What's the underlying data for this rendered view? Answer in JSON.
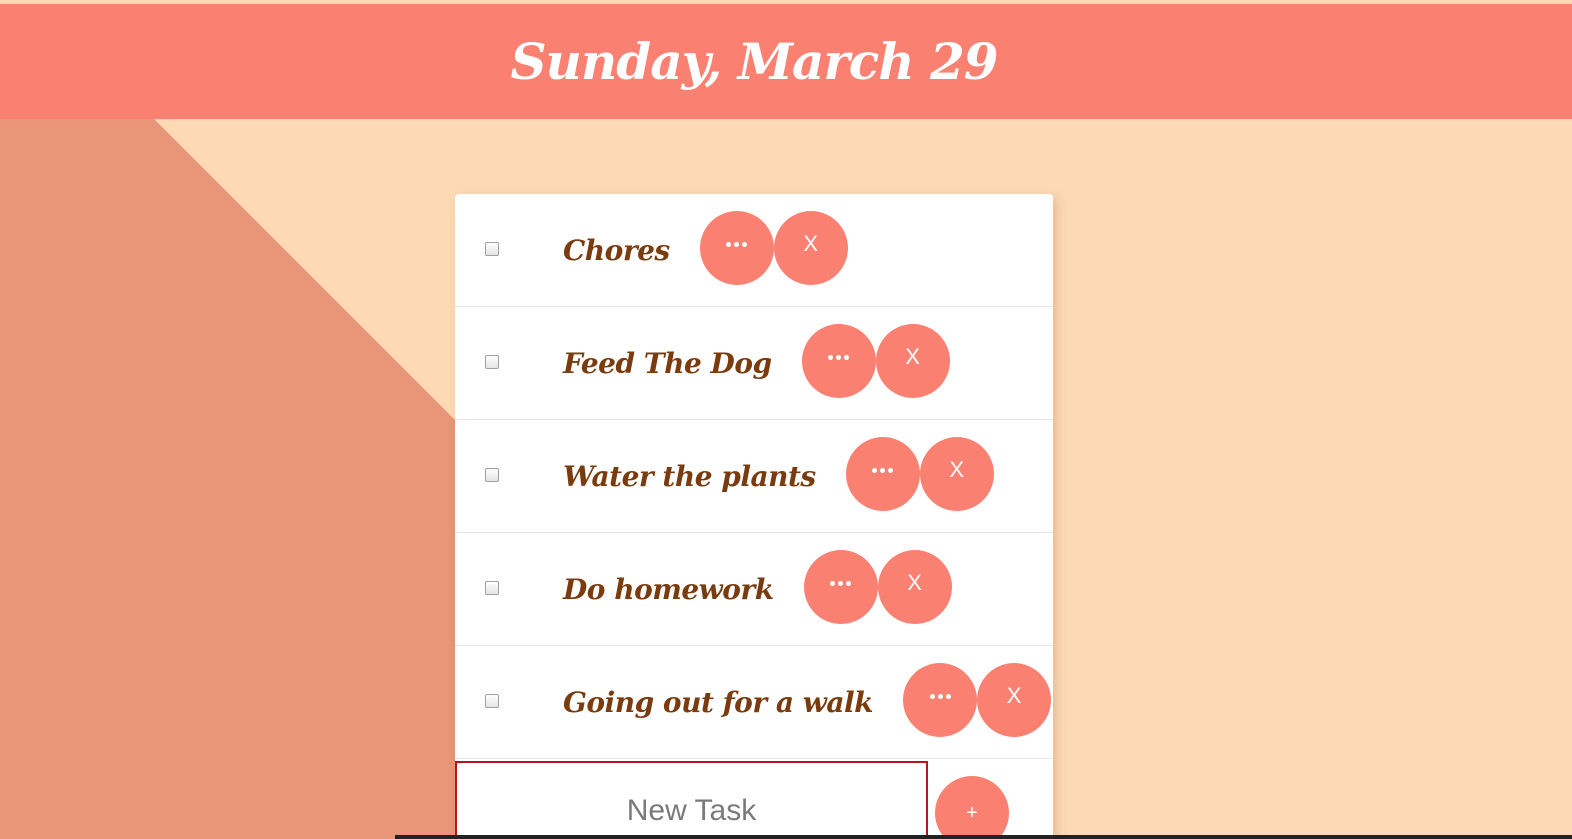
{
  "header": {
    "date": "Sunday, March 29"
  },
  "tasks": [
    {
      "label": "Chores",
      "more_icon": "ellipsis-icon",
      "delete_label": "X"
    },
    {
      "label": "Feed The Dog",
      "more_icon": "ellipsis-icon",
      "delete_label": "X"
    },
    {
      "label": "Water the plants",
      "more_icon": "ellipsis-icon",
      "delete_label": "X"
    },
    {
      "label": "Do homework",
      "more_icon": "ellipsis-icon",
      "delete_label": "X"
    },
    {
      "label": "Going out for a walk",
      "more_icon": "ellipsis-icon",
      "delete_label": "X"
    }
  ],
  "new_task": {
    "placeholder": "New Task",
    "add_label": "+"
  },
  "colors": {
    "accent": "#fa8072",
    "background": "#fdd9b5",
    "diagonal": "#e89677",
    "task_text": "#7a3c0e",
    "input_border": "#b21818"
  }
}
